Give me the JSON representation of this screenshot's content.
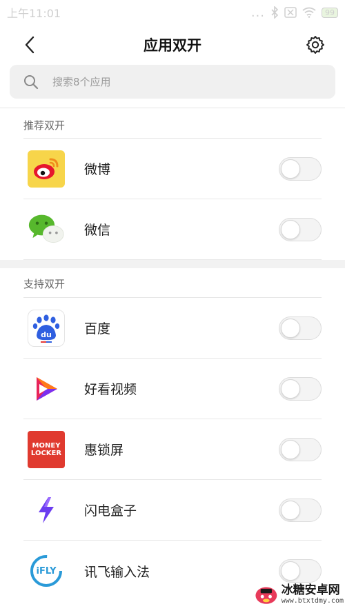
{
  "status_bar": {
    "time": "上午11:01",
    "dots": "...",
    "battery": "99"
  },
  "header": {
    "title": "应用双开"
  },
  "search": {
    "placeholder": "搜索8个应用"
  },
  "sections": [
    {
      "title": "推荐双开",
      "apps": [
        {
          "name": "微博",
          "icon": "weibo-icon",
          "enabled": false
        },
        {
          "name": "微信",
          "icon": "wechat-icon",
          "enabled": false
        }
      ]
    },
    {
      "title": "支持双开",
      "apps": [
        {
          "name": "百度",
          "icon": "baidu-icon",
          "enabled": false
        },
        {
          "name": "好看视频",
          "icon": "haokan-video-icon",
          "enabled": false
        },
        {
          "name": "惠锁屏",
          "icon": "money-locker-icon",
          "icon_text": [
            "MONEY",
            "LOCKER"
          ],
          "enabled": false
        },
        {
          "name": "闪电盒子",
          "icon": "lightning-box-icon",
          "enabled": false
        },
        {
          "name": "讯飞输入法",
          "icon": "ifly-icon",
          "icon_text": "iFLY",
          "enabled": false
        }
      ]
    }
  ],
  "watermark": {
    "main": "冰糖安卓网",
    "sub": "www.btxtdmy.com"
  },
  "colors": {
    "weibo_bg": "#f7d54a",
    "wechat_green": "#57b82d",
    "baidu_blue": "#2f5fe0",
    "locker_red": "#e03a2f",
    "lightning_purple": "#6b3df0",
    "ifly_blue": "#2a9ad8"
  }
}
